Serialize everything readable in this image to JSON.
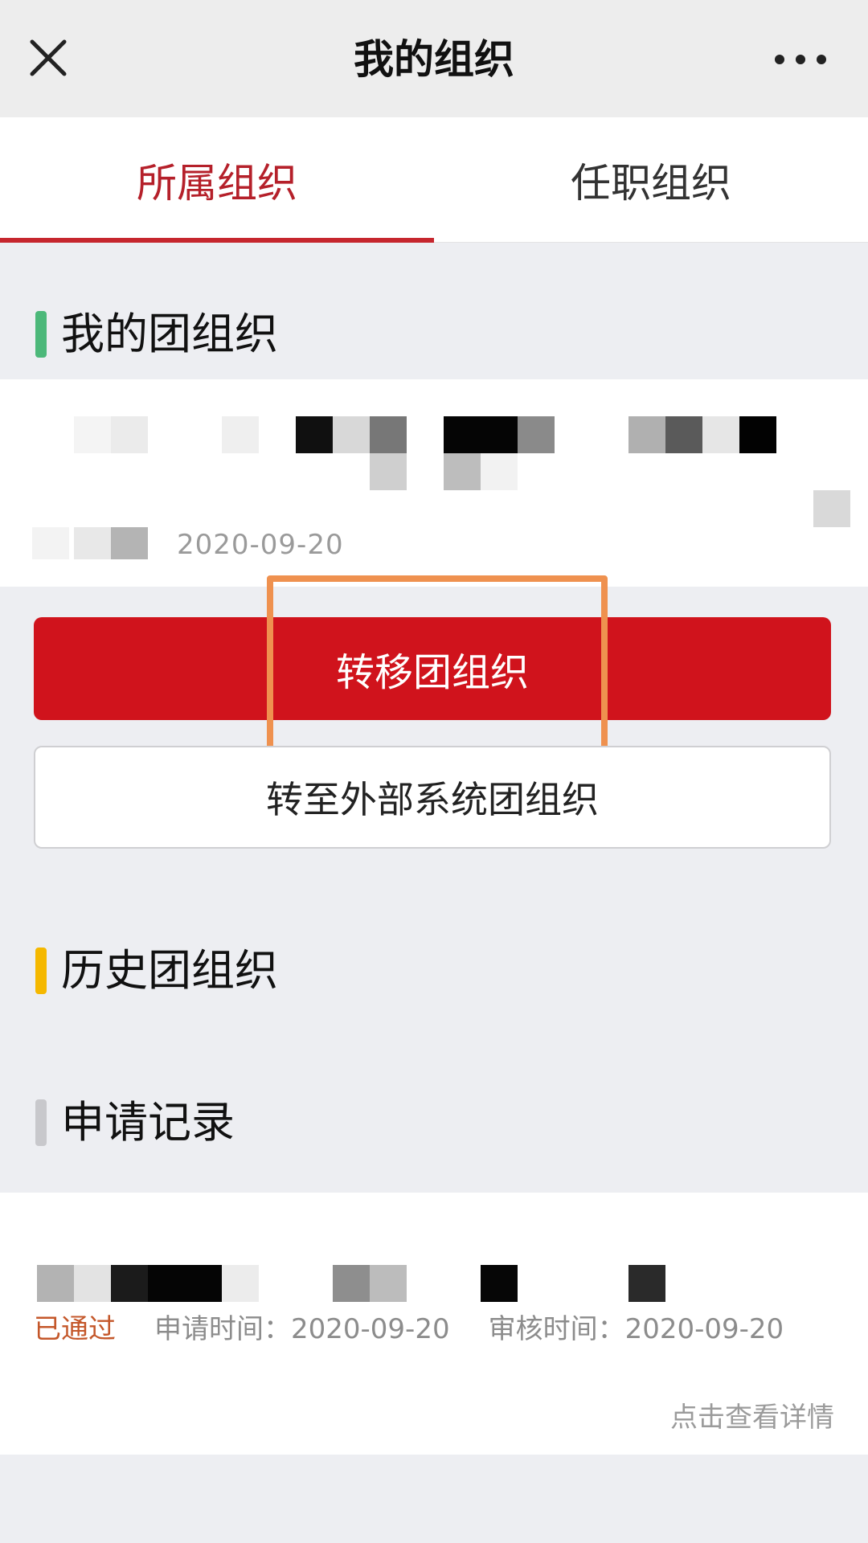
{
  "navbar": {
    "title": "我的组织",
    "close_icon": "close-icon",
    "more_icon": "more-icon"
  },
  "tabs": [
    {
      "label": "所属组织",
      "active": true
    },
    {
      "label": "任职组织",
      "active": false
    }
  ],
  "sections": {
    "my_org": {
      "title": "我的团组织",
      "accent": "#4cb87a"
    },
    "history": {
      "title": "历史团组织",
      "accent": "#f5b800"
    },
    "records": {
      "title": "申请记录",
      "accent": "#c8c8cc"
    }
  },
  "org_card": {
    "date": "2020-09-20"
  },
  "buttons": {
    "transfer": "转移团组织",
    "transfer_external": "转至外部系统团组织"
  },
  "record": {
    "status": "已通过",
    "apply_time_label": "申请时间：",
    "apply_time": "2020-09-20",
    "review_time_label": "审核时间：",
    "review_time": "2020-09-20",
    "detail_link": "点击查看详情"
  },
  "colors": {
    "brand_red": "#d0131c",
    "tab_active": "#b5202a",
    "highlight": "#ef914f",
    "status_passed": "#c4572a"
  }
}
